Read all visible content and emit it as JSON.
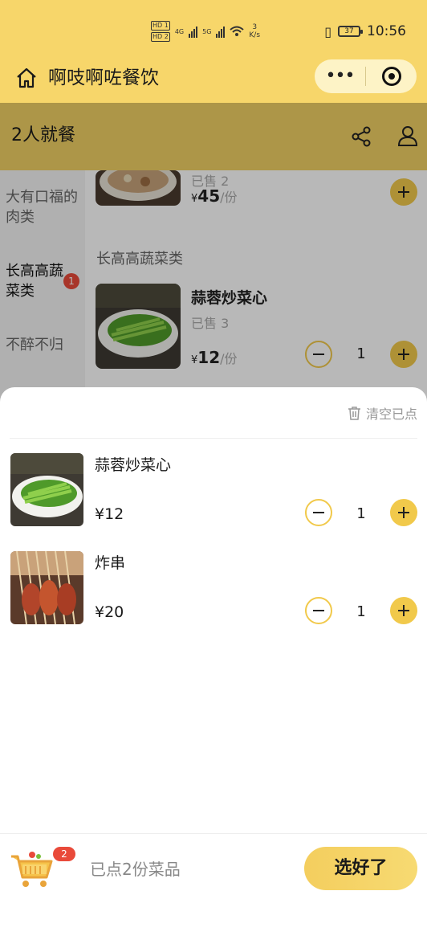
{
  "status_bar": {
    "hd1": "HD 1",
    "hd2": "HD 2",
    "net_4g": "4G",
    "net_5g": "5G",
    "speed_value": "3",
    "speed_unit": "K/s",
    "battery": "37",
    "time": "10:56"
  },
  "title_bar": {
    "title": "啊吱啊咗餐饮",
    "more_label": "•••"
  },
  "sub_header": {
    "title": "2人就餐"
  },
  "categories": [
    {
      "label": "大有口福的肉类"
    },
    {
      "label": "长高高蔬菜类",
      "badge": "1"
    },
    {
      "label": "不醉不归"
    }
  ],
  "menu": {
    "prev_dish": {
      "sold": "已售 2",
      "price_symbol": "¥",
      "price": "45",
      "unit": "/份"
    },
    "section_title": "长高高蔬菜类",
    "dish": {
      "name": "蒜蓉炒菜心",
      "sold": "已售 3",
      "price_symbol": "¥",
      "price": "12",
      "unit": "/份",
      "qty": "1"
    }
  },
  "cart": {
    "clear_label": "清空已点",
    "items": [
      {
        "name": "蒜蓉炒菜心",
        "price": "¥12",
        "qty": "1"
      },
      {
        "name": "炸串",
        "price": "¥20",
        "qty": "1"
      }
    ]
  },
  "bottom_bar": {
    "count": "2",
    "summary": "已点2份菜品",
    "checkout_label": "选好了"
  },
  "colors": {
    "brand_yellow": "#f7d66a",
    "button_yellow": "#f1c94b",
    "badge_red": "#e94a3a"
  }
}
